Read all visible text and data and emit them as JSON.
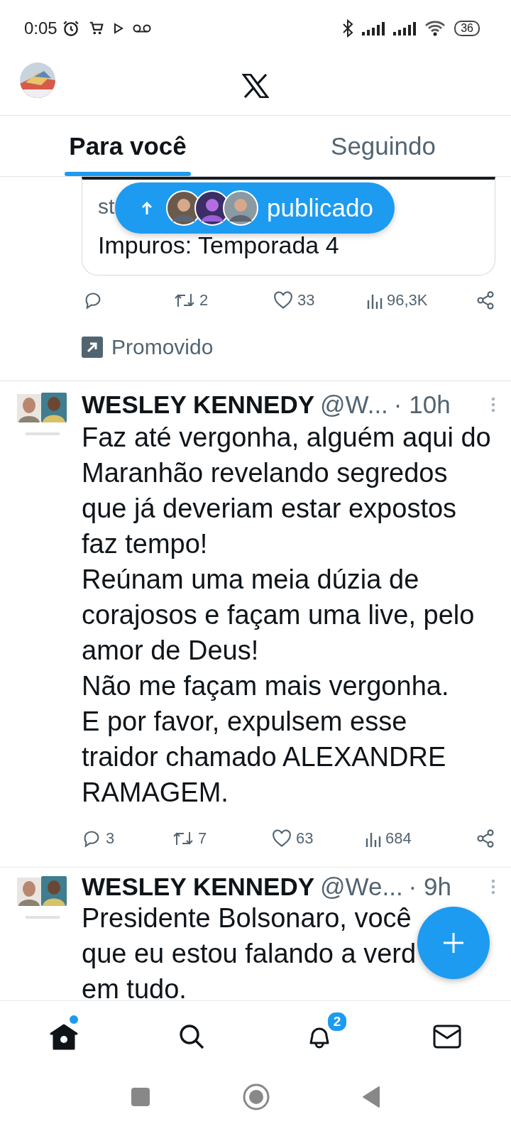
{
  "status_bar": {
    "time": "0:05",
    "battery": "36"
  },
  "tabs": [
    {
      "label": "Para você",
      "selected": true
    },
    {
      "label": "Seguindo",
      "selected": false
    }
  ],
  "new_posts_pill": {
    "label": "publicado"
  },
  "promoted_post": {
    "card_lines": [
      "st",
      "Impuros: Temporada 4"
    ],
    "actions": {
      "reposts": "2",
      "likes": "33",
      "views": "96,3K"
    },
    "promoted_label": "Promovido"
  },
  "posts": [
    {
      "name": "WESLEY KENNEDY",
      "handle": "@W...",
      "time": "· 10h",
      "lines": [
        "Faz até vergonha, alguém aqui do",
        "Maranhão revelando segredos",
        "que já deveriam estar expostos",
        "faz tempo!",
        "Reúnam uma meia dúzia de",
        "corajosos e façam uma live, pelo",
        "amor de Deus!",
        "Não me façam mais vergonha.",
        "E por favor, expulsem esse",
        "traidor chamado ALEXANDRE",
        "RAMAGEM."
      ],
      "actions": {
        "replies": "3",
        "reposts": "7",
        "likes": "63",
        "views": "684"
      }
    },
    {
      "name": "WESLEY KENNEDY",
      "handle": "@We...",
      "time": "· 9h",
      "lines": [
        "Presidente Bolsonaro, você",
        "que eu estou falando a verd",
        "em tudo."
      ]
    }
  ],
  "nav": [
    {
      "kind": "home",
      "selected": true,
      "dot": true
    },
    {
      "kind": "search",
      "selected": false
    },
    {
      "kind": "notifications",
      "selected": false,
      "badge": "2"
    },
    {
      "kind": "messages",
      "selected": false
    }
  ]
}
